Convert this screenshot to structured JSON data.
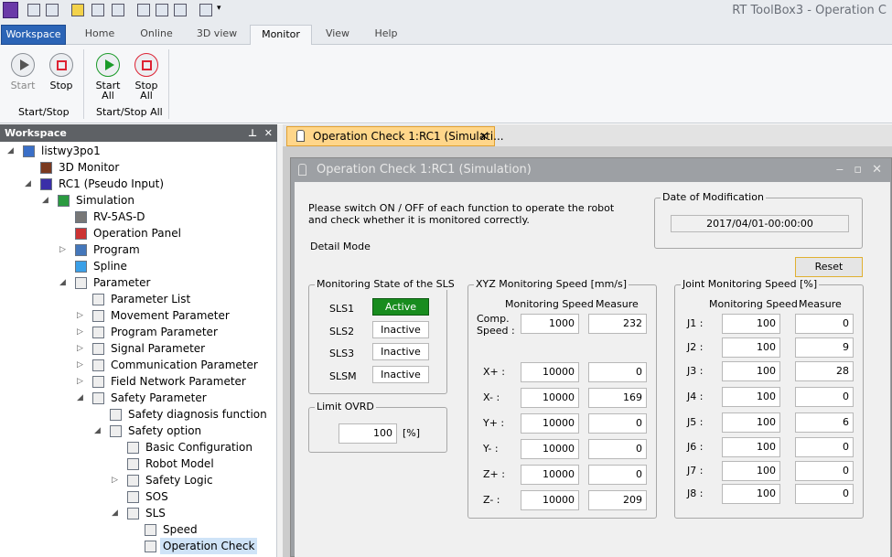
{
  "app_title": "RT ToolBox3 - Operation C",
  "ribbon_tabs": [
    "Workspace",
    "Home",
    "Online",
    "3D view",
    "Monitor",
    "View",
    "Help"
  ],
  "ribbon": {
    "start": "Start",
    "stop": "Stop",
    "start_all": "Start All",
    "stop_all": "Stop All",
    "group1": "Start/Stop",
    "group2": "Start/Stop All"
  },
  "workspace": {
    "title": "Workspace",
    "pin": "ᵖ",
    "close": "✕",
    "tree": [
      {
        "label": "listwy3po1",
        "icon": "project-icon",
        "expand": "◢"
      },
      {
        "label": "3D Monitor",
        "icon": "3d-monitor-icon",
        "expand": ""
      },
      {
        "label": "RC1 (Pseudo Input)",
        "icon": "robot-controller-icon",
        "expand": "◢"
      },
      {
        "label": "Simulation",
        "icon": "simulation-icon",
        "expand": "◢"
      },
      {
        "label": "RV-5AS-D",
        "icon": "robot-model-icon",
        "expand": ""
      },
      {
        "label": "Operation Panel",
        "icon": "operation-panel-icon",
        "expand": ""
      },
      {
        "label": "Program",
        "icon": "program-icon",
        "expand": "▷"
      },
      {
        "label": "Spline",
        "icon": "spline-icon",
        "expand": ""
      },
      {
        "label": "Parameter",
        "icon": "parameter-icon",
        "expand": "◢"
      },
      {
        "label": "Parameter List",
        "icon": "parameter-list-icon",
        "expand": ""
      },
      {
        "label": "Movement Parameter",
        "icon": "parameter-item-icon",
        "expand": "▷"
      },
      {
        "label": "Program Parameter",
        "icon": "parameter-item-icon",
        "expand": "▷"
      },
      {
        "label": "Signal Parameter",
        "icon": "parameter-item-icon",
        "expand": "▷"
      },
      {
        "label": "Communication Parameter",
        "icon": "parameter-item-icon",
        "expand": "▷"
      },
      {
        "label": "Field Network Parameter",
        "icon": "parameter-item-icon",
        "expand": "▷"
      },
      {
        "label": "Safety Parameter",
        "icon": "parameter-item-icon",
        "expand": "◢"
      },
      {
        "label": "Safety diagnosis function",
        "icon": "parameter-item-icon",
        "expand": ""
      },
      {
        "label": "Safety option",
        "icon": "parameter-item-icon",
        "expand": "◢"
      },
      {
        "label": "Basic Configuration",
        "icon": "parameter-item-icon",
        "expand": ""
      },
      {
        "label": "Robot Model",
        "icon": "parameter-item-icon",
        "expand": ""
      },
      {
        "label": "Safety Logic",
        "icon": "parameter-item-icon",
        "expand": "▷"
      },
      {
        "label": "SOS",
        "icon": "parameter-item-icon",
        "expand": ""
      },
      {
        "label": "SLS",
        "icon": "parameter-item-icon",
        "expand": "◢"
      },
      {
        "label": "Speed",
        "icon": "parameter-item-icon",
        "expand": ""
      },
      {
        "label": "Operation Check",
        "icon": "parameter-item-icon",
        "expand": ""
      }
    ]
  },
  "doc_tab": {
    "label": "Operation Check 1:RC1  (Simulati...",
    "close": "✕"
  },
  "window": {
    "title": "Operation Check 1:RC1  (Simulation)",
    "min": "‒",
    "max": "▫",
    "close": "✕",
    "instructions_1": "Please switch ON / OFF of each function to operate the robot",
    "instructions_2": "and check whether it is monitored correctly.",
    "detail_mode": "Detail Mode",
    "date_label": "Date of Modification",
    "date_value": "2017/04/01-00:00:00",
    "reset": "Reset",
    "sls_group": "Monitoring State of the SLS",
    "sls": [
      {
        "label": "SLS1",
        "state": "Active"
      },
      {
        "label": "SLS2",
        "state": "Inactive"
      },
      {
        "label": "SLS3",
        "state": "Inactive"
      },
      {
        "label": "SLSM",
        "state": "Inactive"
      }
    ],
    "limit_group": "Limit OVRD",
    "limit_value": "100",
    "limit_unit": "[%]",
    "xyz_group": "XYZ  Monitoring Speed [mm/s]",
    "xyz_col1": "Monitoring Speed",
    "xyz_col2": "Measure",
    "comp_label_1": "Comp.",
    "comp_label_2": "Speed :",
    "comp": {
      "mon": "1000",
      "meas": "232"
    },
    "xyz": [
      {
        "label": "X+ :",
        "mon": "10000",
        "meas": "0"
      },
      {
        "label": "X- :",
        "mon": "10000",
        "meas": "169"
      },
      {
        "label": "Y+ :",
        "mon": "10000",
        "meas": "0"
      },
      {
        "label": "Y- :",
        "mon": "10000",
        "meas": "0"
      },
      {
        "label": "Z+ :",
        "mon": "10000",
        "meas": "0"
      },
      {
        "label": "Z- :",
        "mon": "10000",
        "meas": "209"
      }
    ],
    "joint_group": "Joint  Monitoring Speed [%]",
    "joint_col1": "Monitoring Speed",
    "joint_col2": "Measure",
    "joints": [
      {
        "label": "J1 :",
        "mon": "100",
        "meas": "0"
      },
      {
        "label": "J2 :",
        "mon": "100",
        "meas": "9"
      },
      {
        "label": "J3 :",
        "mon": "100",
        "meas": "28"
      },
      {
        "label": "J4 :",
        "mon": "100",
        "meas": "0"
      },
      {
        "label": "J5 :",
        "mon": "100",
        "meas": "6"
      },
      {
        "label": "J6 :",
        "mon": "100",
        "meas": "0"
      },
      {
        "label": "J7 :",
        "mon": "100",
        "meas": "0"
      },
      {
        "label": "J8 :",
        "mon": "100",
        "meas": "0"
      }
    ]
  },
  "colors": {
    "active_green": "#188c1e",
    "workspace_blue": "#2b64b6",
    "doc_tab_orange": "#ffd68a"
  }
}
